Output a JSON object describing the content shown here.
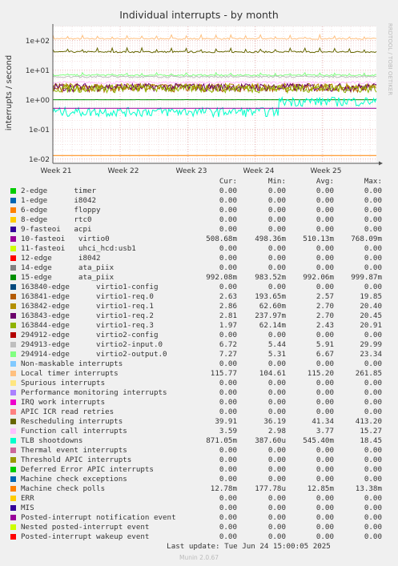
{
  "title": "Individual interrupts - by month",
  "side_label": "RRDTOOL / TOBI OETIKER",
  "footer_update": "Last update: Tue Jun 24 15:00:05 2025",
  "footer_version": "Munin 2.0.67",
  "legend_headers": {
    "cur": "Cur:",
    "min": "Min:",
    "avg": "Avg:",
    "max": "Max:"
  },
  "legend": [
    {
      "label": "2-edge      timer",
      "color": "#00cc00",
      "cur": "0.00",
      "min": "0.00",
      "avg": "0.00",
      "max": "0.00"
    },
    {
      "label": "1-edge      i8042",
      "color": "#0066b3",
      "cur": "0.00",
      "min": "0.00",
      "avg": "0.00",
      "max": "0.00"
    },
    {
      "label": "6-edge      floppy",
      "color": "#ff8000",
      "cur": "0.00",
      "min": "0.00",
      "avg": "0.00",
      "max": "0.00"
    },
    {
      "label": "8-edge      rtc0",
      "color": "#ffcc00",
      "cur": "0.00",
      "min": "0.00",
      "avg": "0.00",
      "max": "0.00"
    },
    {
      "label": "9-fasteoi   acpi",
      "color": "#330099",
      "cur": "0.00",
      "min": "0.00",
      "avg": "0.00",
      "max": "0.00"
    },
    {
      "label": "10-fasteoi   virtio0",
      "color": "#990099",
      "cur": "508.68m",
      "min": "498.36m",
      "avg": "510.13m",
      "max": "768.09m"
    },
    {
      "label": "11-fasteoi   uhci_hcd:usb1",
      "color": "#ccff00",
      "cur": "0.00",
      "min": "0.00",
      "avg": "0.00",
      "max": "0.00"
    },
    {
      "label": "12-edge      i8042",
      "color": "#ff0000",
      "cur": "0.00",
      "min": "0.00",
      "avg": "0.00",
      "max": "0.00"
    },
    {
      "label": "14-edge      ata_piix",
      "color": "#808080",
      "cur": "0.00",
      "min": "0.00",
      "avg": "0.00",
      "max": "0.00"
    },
    {
      "label": "15-edge      ata_piix",
      "color": "#008f00",
      "cur": "992.08m",
      "min": "983.52m",
      "avg": "992.06m",
      "max": "999.87m"
    },
    {
      "label": "163840-edge      virtio1-config",
      "color": "#00487d",
      "cur": "0.00",
      "min": "0.00",
      "avg": "0.00",
      "max": "0.00"
    },
    {
      "label": "163841-edge      virtio1-req.0",
      "color": "#b35a00",
      "cur": "2.63",
      "min": "193.65m",
      "avg": "2.57",
      "max": "19.85"
    },
    {
      "label": "163842-edge      virtio1-req.1",
      "color": "#b38f00",
      "cur": "2.86",
      "min": "62.60m",
      "avg": "2.70",
      "max": "20.40"
    },
    {
      "label": "163843-edge      virtio1-req.2",
      "color": "#6b006b",
      "cur": "2.81",
      "min": "237.97m",
      "avg": "2.70",
      "max": "20.45"
    },
    {
      "label": "163844-edge      virtio1-req.3",
      "color": "#8fb300",
      "cur": "1.97",
      "min": "62.14m",
      "avg": "2.43",
      "max": "20.91"
    },
    {
      "label": "294912-edge      virtio2-config",
      "color": "#b30000",
      "cur": "0.00",
      "min": "0.00",
      "avg": "0.00",
      "max": "0.00"
    },
    {
      "label": "294913-edge      virtio2-input.0",
      "color": "#bebebe",
      "cur": "6.72",
      "min": "5.44",
      "avg": "5.91",
      "max": "29.99"
    },
    {
      "label": "294914-edge      virtio2-output.0",
      "color": "#80ff80",
      "cur": "7.27",
      "min": "5.31",
      "avg": "6.67",
      "max": "23.34"
    },
    {
      "label": "Non-maskable interrupts",
      "color": "#80c9ff",
      "cur": "0.00",
      "min": "0.00",
      "avg": "0.00",
      "max": "0.00"
    },
    {
      "label": "Local timer interrupts",
      "color": "#ffc080",
      "cur": "115.77",
      "min": "104.61",
      "avg": "115.20",
      "max": "261.85"
    },
    {
      "label": "Spurious interrupts",
      "color": "#ffe680",
      "cur": "0.00",
      "min": "0.00",
      "avg": "0.00",
      "max": "0.00"
    },
    {
      "label": "Performance monitoring interrupts",
      "color": "#aa80ff",
      "cur": "0.00",
      "min": "0.00",
      "avg": "0.00",
      "max": "0.00"
    },
    {
      "label": "IRQ work interrupts",
      "color": "#ee00cc",
      "cur": "0.00",
      "min": "0.00",
      "avg": "0.00",
      "max": "0.00"
    },
    {
      "label": "APIC ICR read retries",
      "color": "#ff8080",
      "cur": "0.00",
      "min": "0.00",
      "avg": "0.00",
      "max": "0.00"
    },
    {
      "label": "Rescheduling interrupts",
      "color": "#666600",
      "cur": "39.91",
      "min": "36.19",
      "avg": "41.34",
      "max": "413.20"
    },
    {
      "label": "Function call interrupts",
      "color": "#ffbfff",
      "cur": "3.59",
      "min": "2.98",
      "avg": "3.77",
      "max": "15.27"
    },
    {
      "label": "TLB shootdowns",
      "color": "#00ffcc",
      "cur": "871.05m",
      "min": "387.60u",
      "avg": "545.40m",
      "max": "18.45"
    },
    {
      "label": "Thermal event interrupts",
      "color": "#cc6699",
      "cur": "0.00",
      "min": "0.00",
      "avg": "0.00",
      "max": "0.00"
    },
    {
      "label": "Threshold APIC interrupts",
      "color": "#999900",
      "cur": "0.00",
      "min": "0.00",
      "avg": "0.00",
      "max": "0.00"
    },
    {
      "label": "Deferred Error APIC interrupts",
      "color": "#00cc00",
      "cur": "0.00",
      "min": "0.00",
      "avg": "0.00",
      "max": "0.00"
    },
    {
      "label": "Machine check exceptions",
      "color": "#0066b3",
      "cur": "0.00",
      "min": "0.00",
      "avg": "0.00",
      "max": "0.00"
    },
    {
      "label": "Machine check polls",
      "color": "#ff8000",
      "cur": "12.78m",
      "min": "177.78u",
      "avg": "12.85m",
      "max": "13.38m"
    },
    {
      "label": "ERR",
      "color": "#ffcc00",
      "cur": "0.00",
      "min": "0.00",
      "avg": "0.00",
      "max": "0.00"
    },
    {
      "label": "MIS",
      "color": "#330099",
      "cur": "0.00",
      "min": "0.00",
      "avg": "0.00",
      "max": "0.00"
    },
    {
      "label": "Posted-interrupt notification event",
      "color": "#990099",
      "cur": "0.00",
      "min": "0.00",
      "avg": "0.00",
      "max": "0.00"
    },
    {
      "label": "Nested posted-interrupt event",
      "color": "#ccff00",
      "cur": "0.00",
      "min": "0.00",
      "avg": "0.00",
      "max": "0.00"
    },
    {
      "label": "Posted-interrupt wakeup event",
      "color": "#ff0000",
      "cur": "0.00",
      "min": "0.00",
      "avg": "0.00",
      "max": "0.00"
    }
  ],
  "chart_data": {
    "type": "line",
    "title": "Individual interrupts - by month",
    "ylabel": "interrupts / second",
    "yscale": "log",
    "ylim": [
      0.007,
      300
    ],
    "y_ticks": [
      {
        "label": "1e-02",
        "value": 0.01
      },
      {
        "label": "1e-01",
        "value": 0.1
      },
      {
        "label": "1e+00",
        "value": 1
      },
      {
        "label": "1e+01",
        "value": 10
      },
      {
        "label": "1e+02",
        "value": 100
      }
    ],
    "x_ticks": [
      "Week 21",
      "Week 22",
      "Week 23",
      "Week 24",
      "Week 25"
    ],
    "grid": true,
    "series": [
      {
        "name": "Local timer interrupts",
        "color": "#ffc080",
        "value": 115.2,
        "noise": 0.05,
        "spikes": 0.25,
        "step": null
      },
      {
        "name": "Rescheduling interrupts",
        "color": "#666600",
        "value": 41.3,
        "noise": 0.06,
        "spikes": 0.25,
        "step": null
      },
      {
        "name": "294914-edge      virtio2-output.0",
        "color": "#80ff80",
        "value": 6.7,
        "noise": 0.06,
        "spikes": 0.15,
        "step": null
      },
      {
        "name": "294913-edge      virtio2-input.0",
        "color": "#bebebe",
        "value": 5.9,
        "noise": 0.06,
        "spikes": 0.1,
        "step": null
      },
      {
        "name": "Function call interrupts",
        "color": "#ffbfff",
        "value": 3.77,
        "noise": 0.12,
        "spikes": 0.0,
        "step": null
      },
      {
        "name": "163841-edge      virtio1-req.0",
        "color": "#b35a00",
        "value": 2.57,
        "noise": 0.3,
        "spikes": 0.0,
        "step": null
      },
      {
        "name": "163842-edge      virtio1-req.1",
        "color": "#b38f00",
        "value": 2.7,
        "noise": 0.3,
        "spikes": 0.0,
        "step": null
      },
      {
        "name": "163843-edge      virtio1-req.2",
        "color": "#6b006b",
        "value": 2.7,
        "noise": 0.3,
        "spikes": 0.0,
        "step": null
      },
      {
        "name": "163844-edge      virtio1-req.3",
        "color": "#8fb300",
        "value": 2.43,
        "noise": 0.3,
        "spikes": 0.0,
        "step": null
      },
      {
        "name": "15-edge      ata_piix",
        "color": "#008f00",
        "value": 0.992,
        "noise": 0.003,
        "spikes": 0.0,
        "step": null
      },
      {
        "name": "TLB shootdowns",
        "color": "#00ffcc",
        "value": 0.4,
        "noise": 0.35,
        "spikes": 0.0,
        "step": {
          "at": 0.7,
          "value": 0.9
        }
      },
      {
        "name": "10-fasteoi   virtio0",
        "color": "#990099",
        "value": 0.51,
        "noise": 0.002,
        "spikes": 0.0,
        "step": null
      },
      {
        "name": "Machine check polls",
        "color": "#ff8000",
        "value": 0.01285,
        "noise": 0.002,
        "spikes": 0.0,
        "step": null
      }
    ]
  }
}
